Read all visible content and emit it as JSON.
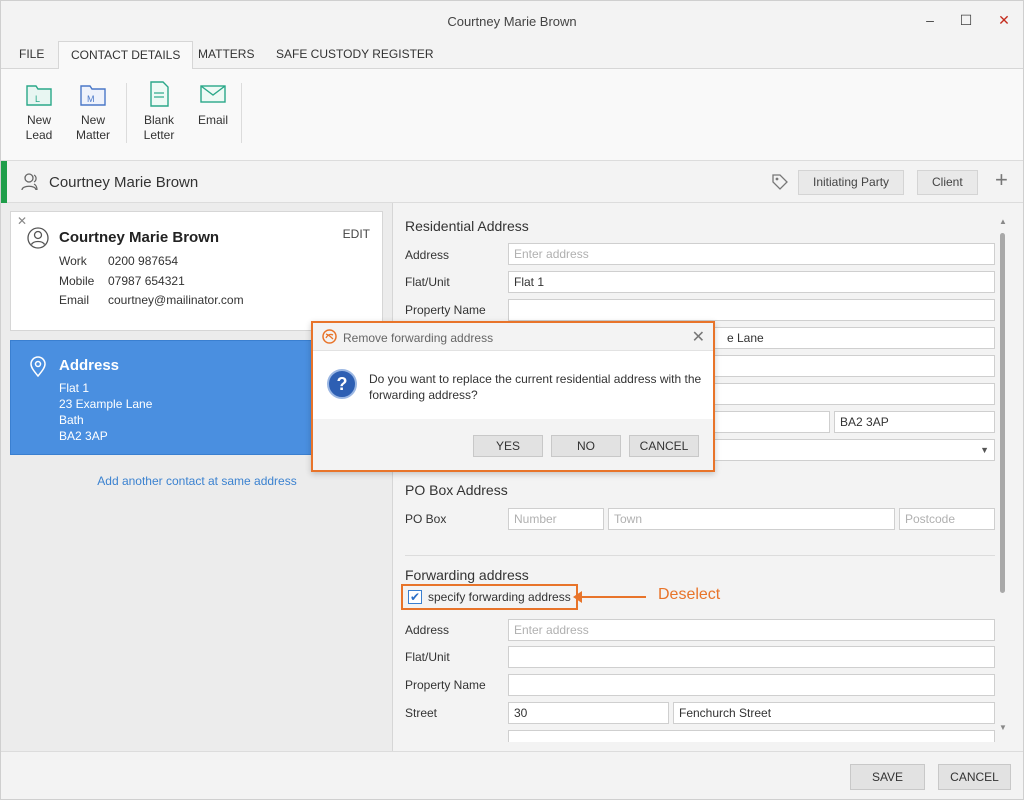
{
  "window": {
    "title": "Courtney Marie Brown",
    "minimize": "–",
    "maximize": "☐",
    "close": "✕"
  },
  "tabs": [
    "FILE",
    "CONTACT DETAILS",
    "MATTERS",
    "SAFE CUSTODY REGISTER"
  ],
  "ribbon": {
    "new_lead": [
      "New",
      "Lead"
    ],
    "new_matter": [
      "New",
      "Matter"
    ],
    "blank_letter": [
      "Blank",
      "Letter"
    ],
    "email": "Email"
  },
  "header": {
    "name": "Courtney Marie Brown",
    "tag1": "Initiating Party",
    "tag2": "Client",
    "add": "+"
  },
  "contact": {
    "name": "Courtney Marie Brown",
    "edit": "EDIT",
    "rows": [
      {
        "label": "Work",
        "value": "0200 987654"
      },
      {
        "label": "Mobile",
        "value": "07987 654321"
      },
      {
        "label": "Email",
        "value": "courtney@mailinator.com"
      }
    ]
  },
  "address_card": {
    "title": "Address",
    "lines": [
      "Flat 1",
      "23 Example Lane",
      "Bath",
      "BA2 3AP"
    ]
  },
  "add_link": "Add another contact at same address",
  "residential": {
    "title": "Residential Address",
    "address_label": "Address",
    "address_placeholder": "Enter address",
    "flat_label": "Flat/Unit",
    "flat_value": "Flat 1",
    "property_label": "Property Name",
    "street_partial": "e Lane",
    "postcode_value": "BA2 3AP"
  },
  "pobox": {
    "title": "PO Box Address",
    "label": "PO Box",
    "number_placeholder": "Number",
    "town_placeholder": "Town",
    "postcode_placeholder": "Postcode"
  },
  "forwarding": {
    "title": "Forwarding address",
    "checkbox_label": "specify forwarding address",
    "checked": true,
    "address_label": "Address",
    "address_placeholder": "Enter address",
    "flat_label": "Flat/Unit",
    "property_label": "Property Name",
    "street_label": "Street",
    "street_number": "30",
    "street_name": "Fenchurch Street"
  },
  "annotation": {
    "text": "Deselect",
    "color": "#e8742a"
  },
  "footer": {
    "save": "SAVE",
    "cancel": "CANCEL"
  },
  "dialog": {
    "title": "Remove forwarding address",
    "message": "Do you want to replace the current residential address with the forwarding address?",
    "yes": "YES",
    "no": "NO",
    "cancel": "CANCEL"
  },
  "colors": {
    "accent": "#4a8fe0",
    "green": "#1f9e4a",
    "highlight": "#e8742a"
  }
}
